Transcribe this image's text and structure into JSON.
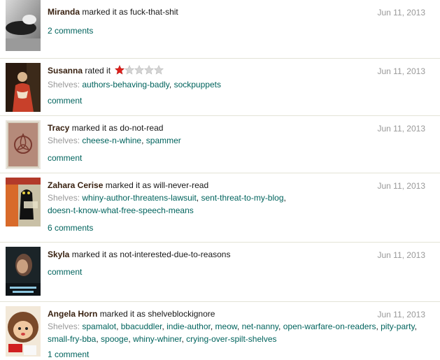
{
  "reviews": [
    {
      "user": "Miranda",
      "action": "marked it as fuck-that-shit",
      "date": "Jun 11, 2013",
      "shelves_label": "",
      "shelves": [],
      "comments": "2 comments"
    },
    {
      "user": "Susanna",
      "action": "rated it",
      "rating": 1,
      "rating_max": 5,
      "date": "Jun 11, 2013",
      "shelves_label": "Shelves:",
      "shelves": [
        "authors-behaving-badly",
        "sockpuppets"
      ],
      "comments": "comment"
    },
    {
      "user": "Tracy",
      "action": "marked it as do-not-read",
      "date": "Jun 11, 2013",
      "shelves_label": "Shelves:",
      "shelves": [
        "cheese-n-whine",
        "spammer"
      ],
      "comments": "comment"
    },
    {
      "user": "Zahara Cerise",
      "action": "marked it as will-never-read",
      "date": "Jun 11, 2013",
      "shelves_label": "Shelves:",
      "shelves": [
        "whiny-author-threatens-lawsuit",
        "sent-threat-to-my-blog",
        "doesn-t-know-what-free-speech-means"
      ],
      "comments": "6 comments"
    },
    {
      "user": "Skyla",
      "action": "marked it as not-interested-due-to-reasons",
      "date": "Jun 11, 2013",
      "shelves_label": "",
      "shelves": [],
      "comments": "comment"
    },
    {
      "user": "Angela Horn",
      "action": "marked it as shelveblockignore",
      "date": "Jun 11, 2013",
      "shelves_label": "Shelves:",
      "shelves": [
        "spamalot",
        "bbacuddler",
        "indie-author",
        "meow",
        "net-nanny",
        "open-warfare-on-readers",
        "pity-party",
        "small-fry-bba",
        "spooge",
        "whiny-whiner",
        "crying-over-spilt-shelves"
      ],
      "comments": "1 comment"
    }
  ],
  "colors": {
    "user": "#382110",
    "link": "#00635d",
    "muted": "#999999",
    "star_on": "#e0201b",
    "star_off": "#d4d4d4"
  }
}
